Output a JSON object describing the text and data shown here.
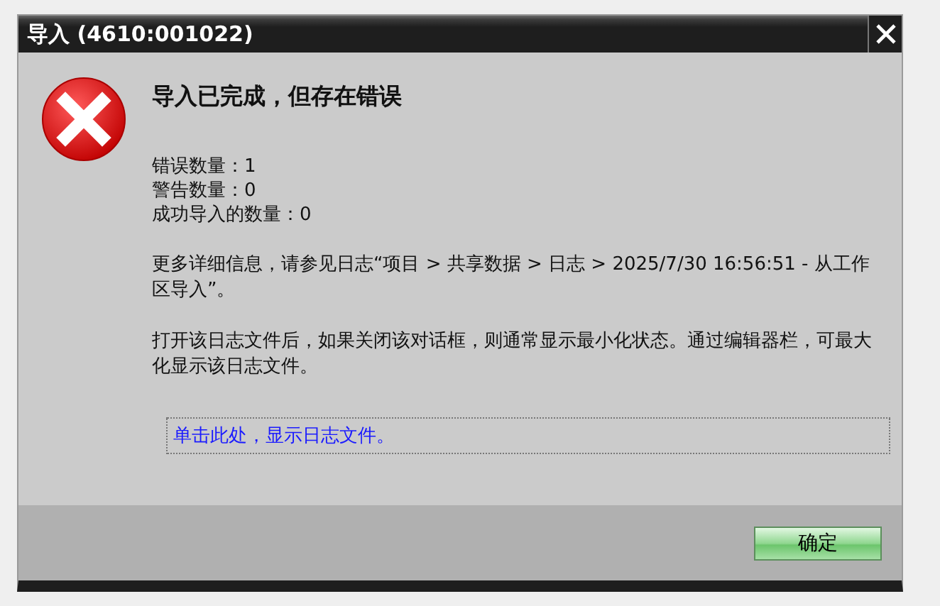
{
  "window": {
    "title": "导入 (4610:001022)"
  },
  "message": {
    "heading": "导入已完成，但存在错误",
    "counts": [
      "错误数量：1",
      "警告数量：0",
      "成功导入的数量：0"
    ],
    "paragraphs": [
      "更多详细信息，请参见日志“项目 > 共享数据 > 日志 > 2025/7/30 16:56:51 - 从工作区导入”。",
      "打开该日志文件后，如果关闭该对话框，则通常显示最小化状态。通过编辑器栏，可最大化显示该日志文件。"
    ],
    "link": "单击此处，显示日志文件。"
  },
  "buttons": [
    "确定"
  ]
}
